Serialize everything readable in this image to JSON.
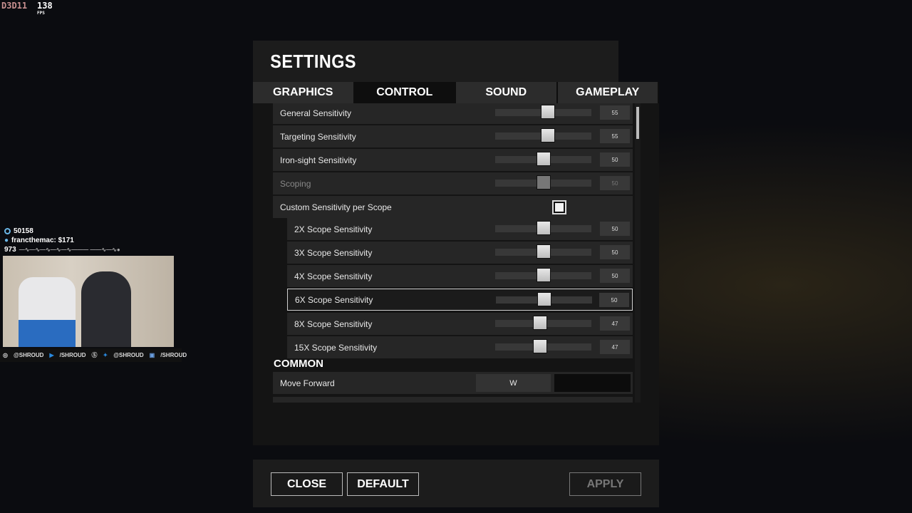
{
  "overlay": {
    "device": "D3D11",
    "fps": "138",
    "fps_unit": "FPS"
  },
  "stream": {
    "followers": "50158",
    "donation": "francthemac: $171",
    "viewers": "973",
    "social": [
      "@SHROUD",
      "/SHROUD",
      "@SHROUD",
      "/SHROUD"
    ]
  },
  "settings": {
    "title": "SETTINGS",
    "tabs": [
      {
        "label": "GRAPHICS"
      },
      {
        "label": "CONTROL",
        "active": true
      },
      {
        "label": "SOUND"
      },
      {
        "label": "GAMEPLAY"
      }
    ],
    "rows": [
      {
        "label": "General Sensitivity",
        "value": 55
      },
      {
        "label": "Targeting Sensitivity",
        "value": 55
      },
      {
        "label": "Iron-sight Sensitivity",
        "value": 50
      },
      {
        "label": "Scoping",
        "value": 50,
        "disabled": true
      },
      {
        "label": "Custom Sensitivity per Scope",
        "checked": true
      },
      {
        "label": "2X Scope Sensitivity",
        "value": 50
      },
      {
        "label": "3X Scope Sensitivity",
        "value": 50
      },
      {
        "label": "4X Scope Sensitivity",
        "value": 50
      },
      {
        "label": "6X Scope Sensitivity",
        "value": 50,
        "selected": true
      },
      {
        "label": "8X Scope Sensitivity",
        "value": 47
      },
      {
        "label": "15X Scope Sensitivity",
        "value": 47
      }
    ],
    "common_header": "COMMON",
    "keybind": {
      "label": "Move Forward",
      "key": "W"
    },
    "buttons": {
      "close": "CLOSE",
      "default": "DEFAULT",
      "apply": "APPLY"
    }
  }
}
